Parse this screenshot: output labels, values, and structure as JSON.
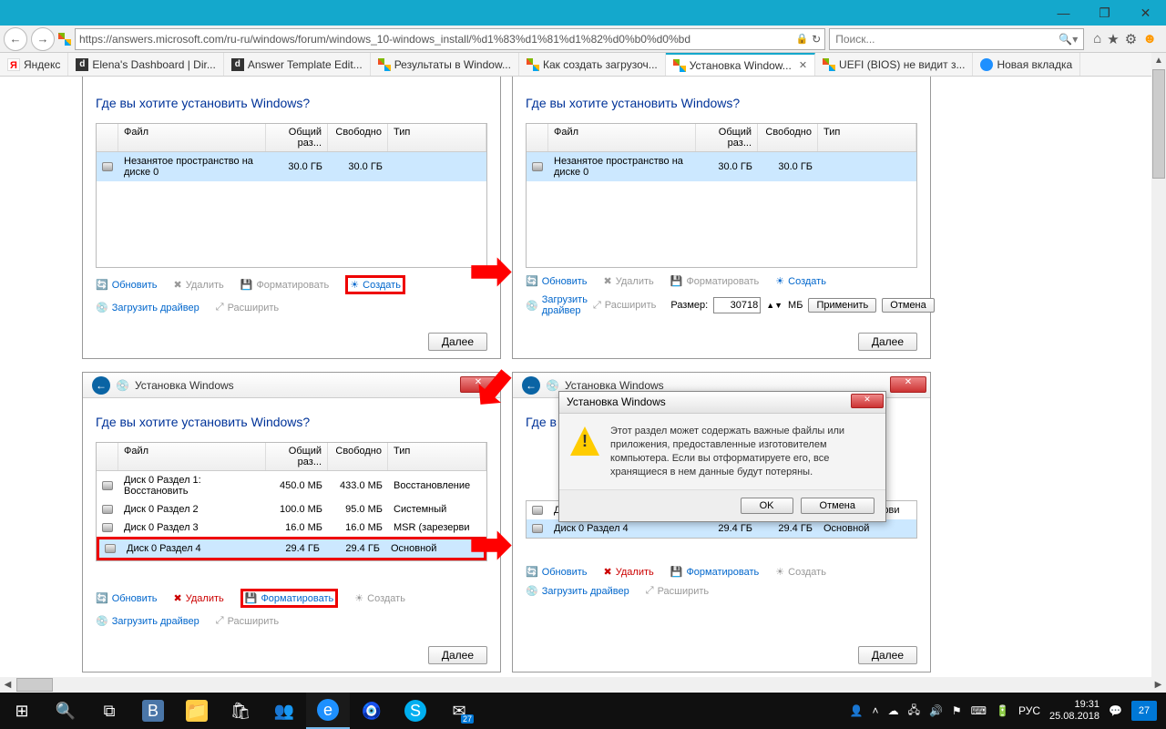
{
  "window": {
    "minimize": "—",
    "maximize": "❐",
    "close": "✕"
  },
  "nav": {
    "url": "https://answers.microsoft.com/ru-ru/windows/forum/windows_10-windows_install/%d1%83%d1%81%d1%82%d0%b0%d0%bd",
    "search_placeholder": "Поиск...",
    "lock": "🔒"
  },
  "tabs": [
    {
      "label": "Яндекс",
      "icon": "y"
    },
    {
      "label": "Elena's Dashboard | Dir...",
      "icon": "d"
    },
    {
      "label": "Answer Template Edit...",
      "icon": "d"
    },
    {
      "label": "Результаты в Window...",
      "icon": "ms"
    },
    {
      "label": "Как создать загрузоч...",
      "icon": "ms"
    },
    {
      "label": "Установка Window...",
      "icon": "ms",
      "active": true
    },
    {
      "label": "UEFI (BIOS) не видит з...",
      "icon": "ms"
    },
    {
      "label": "Новая вкладка",
      "icon": "ie"
    }
  ],
  "installer": {
    "window_title": "Установка Windows",
    "heading": "Где вы хотите установить Windows?",
    "cols": {
      "name": "Файл",
      "total": "Общий раз...",
      "free": "Свободно",
      "type": "Тип"
    },
    "unalloc": {
      "name": "Незанятое пространство на диске 0",
      "total": "30.0 ГБ",
      "free": "30.0 ГБ"
    },
    "partitions": [
      {
        "name": "Диск 0 Раздел 1: Восстановить",
        "total": "450.0 МБ",
        "free": "433.0 МБ",
        "type": "Восстановление"
      },
      {
        "name": "Диск 0 Раздел 2",
        "total": "100.0 МБ",
        "free": "95.0 МБ",
        "type": "Системный"
      },
      {
        "name": "Диск 0 Раздел 3",
        "total": "16.0 МБ",
        "free": "16.0 МБ",
        "type": "MSR (зарезерви"
      },
      {
        "name": "Диск 0 Раздел 4",
        "total": "29.4 ГБ",
        "free": "29.4 ГБ",
        "type": "Основной"
      }
    ],
    "tools": {
      "refresh": "Обновить",
      "delete": "Удалить",
      "format": "Форматировать",
      "new": "Создать",
      "load": "Загрузить драйвер",
      "extend": "Расширить"
    },
    "size": {
      "label": "Размер:",
      "value": "30718",
      "unit": "МБ",
      "apply": "Применить",
      "cancel": "Отмена"
    },
    "next": "Далее"
  },
  "msgbox": {
    "title": "Установка Windows",
    "text": "Этот раздел может содержать важные файлы или приложения, предоставленные изготовителем компьютера. Если вы отформатируете его, все хранящиеся в нем данные будут потеряны.",
    "ok": "OK",
    "cancel": "Отмена"
  },
  "tray": {
    "lang": "РУС",
    "time": "19:31",
    "date": "25.08.2018",
    "badge": "27"
  }
}
